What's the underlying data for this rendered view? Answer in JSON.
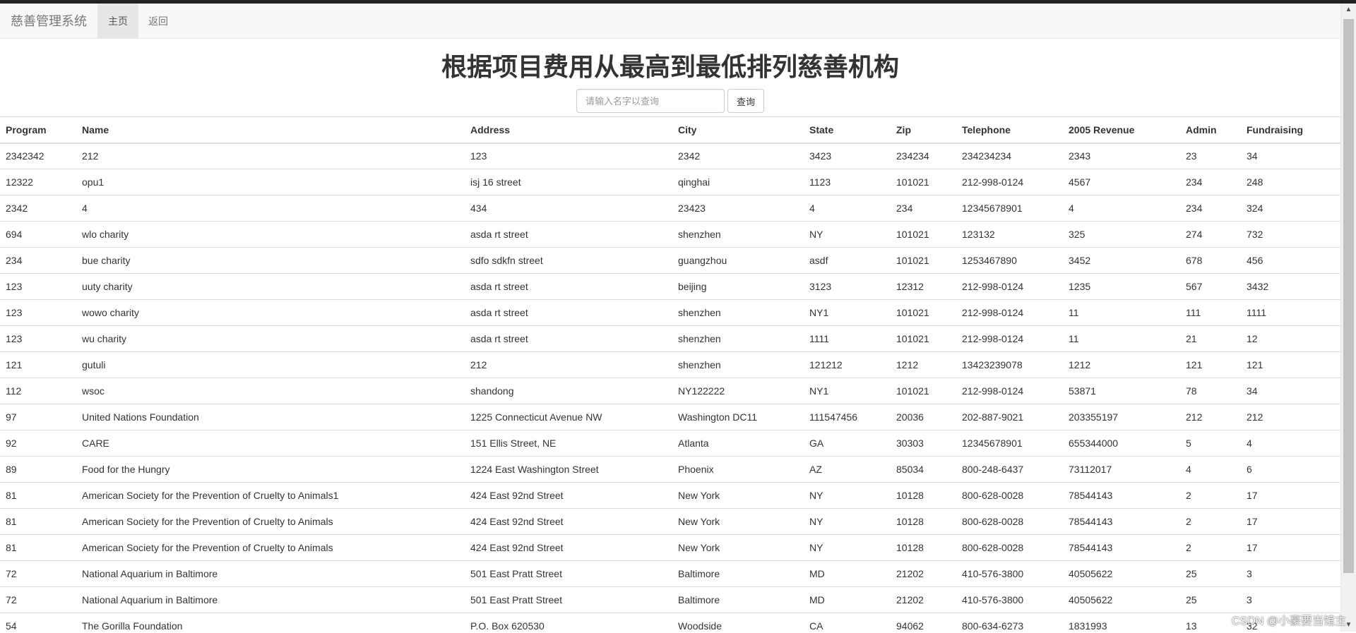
{
  "navbar": {
    "brand": "慈善管理系统",
    "items": [
      {
        "label": "主页",
        "active": true
      },
      {
        "label": "返回",
        "active": false
      }
    ]
  },
  "page": {
    "title": "根据项目费用从最高到最低排列慈善机构"
  },
  "search": {
    "placeholder": "请输入名字以查询",
    "value": "",
    "button_label": "查询"
  },
  "table": {
    "columns": [
      "Program",
      "Name",
      "Address",
      "City",
      "State",
      "Zip",
      "Telephone",
      "2005 Revenue",
      "Admin",
      "Fundraising"
    ],
    "rows": [
      [
        "2342342",
        "212",
        "123",
        "2342",
        "3423",
        "234234",
        "234234234",
        "2343",
        "23",
        "34"
      ],
      [
        "12322",
        "opu1",
        "isj 16 street",
        "qinghai",
        "1123",
        "101021",
        "212-998-0124",
        "4567",
        "234",
        "248"
      ],
      [
        "2342",
        "4",
        "434",
        "23423",
        "4",
        "234",
        "12345678901",
        "4",
        "234",
        "324"
      ],
      [
        "694",
        "wlo charity",
        "asda rt street",
        "shenzhen",
        "NY",
        "101021",
        "123132",
        "325",
        "274",
        "732"
      ],
      [
        "234",
        "bue charity",
        "sdfo sdkfn street",
        "guangzhou",
        "asdf",
        "101021",
        "1253467890",
        "3452",
        "678",
        "456"
      ],
      [
        "123",
        "uuty charity",
        "asda rt street",
        "beijing",
        "3123",
        "12312",
        "212-998-0124",
        "1235",
        "567",
        "3432"
      ],
      [
        "123",
        "wowo charity",
        "asda rt street",
        "shenzhen",
        "NY1",
        "101021",
        "212-998-0124",
        "11",
        "111",
        "1111"
      ],
      [
        "123",
        "wu charity",
        "asda rt street",
        "shenzhen",
        "1111",
        "101021",
        "212-998-0124",
        "11",
        "21",
        "12"
      ],
      [
        "121",
        "gutuli",
        "212",
        "shenzhen",
        "121212",
        "1212",
        "13423239078",
        "1212",
        "121",
        "121"
      ],
      [
        "112",
        "wsoc",
        "shandong",
        "NY122222",
        "NY1",
        "101021",
        "212-998-0124",
        "53871",
        "78",
        "34"
      ],
      [
        "97",
        "United Nations Foundation",
        "1225 Connecticut Avenue NW",
        "Washington DC11",
        "111547456",
        "20036",
        "202-887-9021",
        "203355197",
        "212",
        "212"
      ],
      [
        "92",
        "CARE",
        "151 Ellis Street, NE",
        "Atlanta",
        "GA",
        "30303",
        "12345678901",
        "655344000",
        "5",
        "4"
      ],
      [
        "89",
        "Food for the Hungry",
        "1224 East Washington Street",
        "Phoenix",
        "AZ",
        "85034",
        "800-248-6437",
        "73112017",
        "4",
        "6"
      ],
      [
        "81",
        "American Society for the Prevention of Cruelty to Animals1",
        "424 East 92nd Street",
        "New York",
        "NY",
        "10128",
        "800-628-0028",
        "78544143",
        "2",
        "17"
      ],
      [
        "81",
        "American Society for the Prevention of Cruelty to Animals",
        "424 East 92nd Street",
        "New York",
        "NY",
        "10128",
        "800-628-0028",
        "78544143",
        "2",
        "17"
      ],
      [
        "81",
        "American Society for the Prevention of Cruelty to Animals",
        "424 East 92nd Street",
        "New York",
        "NY",
        "10128",
        "800-628-0028",
        "78544143",
        "2",
        "17"
      ],
      [
        "72",
        "National Aquarium in Baltimore",
        "501 East Pratt Street",
        "Baltimore",
        "MD",
        "21202",
        "410-576-3800",
        "40505622",
        "25",
        "3"
      ],
      [
        "72",
        "National Aquarium in Baltimore",
        "501 East Pratt Street",
        "Baltimore",
        "MD",
        "21202",
        "410-576-3800",
        "40505622",
        "25",
        "3"
      ],
      [
        "54",
        "The Gorilla Foundation",
        "P.O. Box 620530",
        "Woodside",
        "CA",
        "94062",
        "800-634-6273",
        "1831993",
        "13",
        "32"
      ]
    ]
  },
  "watermark": "CSDN @小豪要当馆主",
  "icons": {
    "scroll_up": "scroll-up-arrow-icon",
    "scroll_down": "scroll-down-arrow-icon"
  }
}
